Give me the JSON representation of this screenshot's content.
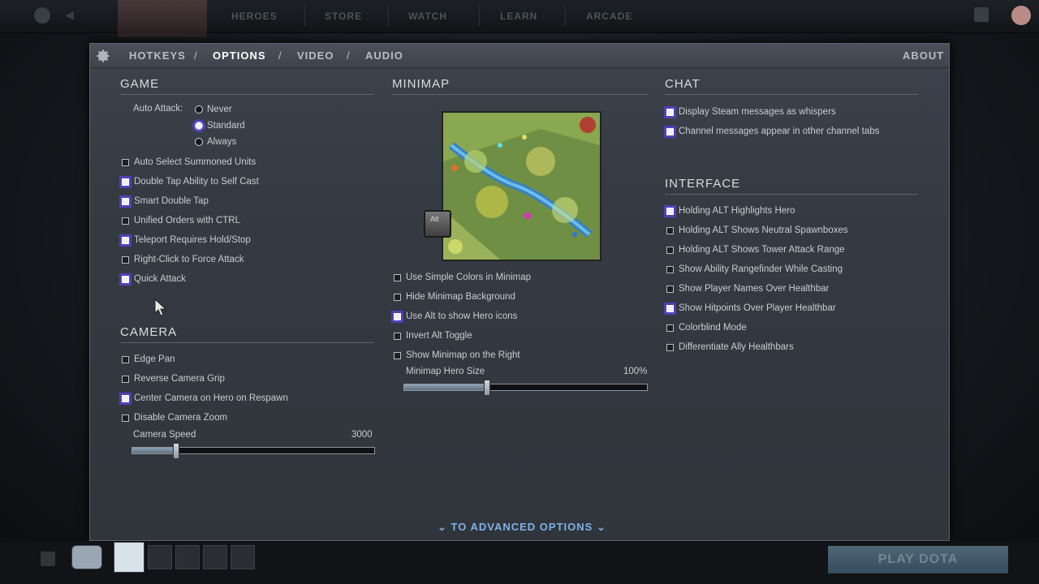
{
  "topnav": {
    "items": [
      "HEROES",
      "STORE",
      "WATCH",
      "LEARN",
      "ARCADE"
    ]
  },
  "tabs": {
    "hotkeys": "HOTKEYS",
    "options": "OPTIONS",
    "video": "VIDEO",
    "audio": "AUDIO",
    "separator": "/",
    "about": "ABOUT",
    "active": "OPTIONS"
  },
  "game": {
    "title": "GAME",
    "auto_attack_label": "Auto Attack:",
    "auto_attack_options": [
      {
        "label": "Never",
        "selected": false
      },
      {
        "label": "Standard",
        "selected": true
      },
      {
        "label": "Always",
        "selected": false
      }
    ],
    "checkboxes": [
      {
        "label": "Auto Select Summoned Units",
        "checked": false
      },
      {
        "label": "Double Tap Ability to Self Cast",
        "checked": true
      },
      {
        "label": "Smart Double Tap",
        "checked": true
      },
      {
        "label": "Unified Orders with CTRL",
        "checked": false
      },
      {
        "label": "Teleport Requires Hold/Stop",
        "checked": true
      },
      {
        "label": "Right-Click to Force Attack",
        "checked": false
      },
      {
        "label": "Quick Attack",
        "checked": true
      }
    ]
  },
  "camera": {
    "title": "CAMERA",
    "checkboxes": [
      {
        "label": "Edge Pan",
        "checked": false
      },
      {
        "label": "Reverse Camera Grip",
        "checked": false
      },
      {
        "label": "Center Camera on Hero on Respawn",
        "checked": true
      },
      {
        "label": "Disable Camera Zoom",
        "checked": false
      }
    ],
    "speed_label": "Camera Speed",
    "speed_value": "3000",
    "speed_fraction": 0.18
  },
  "minimap": {
    "title": "MINIMAP",
    "alt_key_label": "Alt",
    "checkboxes": [
      {
        "label": "Use Simple Colors in Minimap",
        "checked": false
      },
      {
        "label": "Hide Minimap Background",
        "checked": false
      },
      {
        "label": "Use Alt to show Hero icons",
        "checked": true
      },
      {
        "label": "Invert Alt Toggle",
        "checked": false
      },
      {
        "label": "Show Minimap on the Right",
        "checked": false
      }
    ],
    "hero_size_label": "Minimap Hero Size",
    "hero_size_value": "100%",
    "hero_size_fraction": 0.34
  },
  "chat": {
    "title": "CHAT",
    "checkboxes": [
      {
        "label": "Display Steam messages as whispers",
        "checked": true
      },
      {
        "label": "Channel messages appear in other channel tabs",
        "checked": true
      }
    ]
  },
  "interface": {
    "title": "INTERFACE",
    "checkboxes": [
      {
        "label": "Holding ALT Highlights Hero",
        "checked": true
      },
      {
        "label": "Holding ALT Shows Neutral Spawnboxes",
        "checked": false
      },
      {
        "label": "Holding ALT Shows Tower Attack Range",
        "checked": false
      },
      {
        "label": "Show Ability Rangefinder While Casting",
        "checked": false
      },
      {
        "label": "Show Player Names Over Healthbar",
        "checked": false
      },
      {
        "label": "Show Hitpoints Over Player Healthbar",
        "checked": true
      },
      {
        "label": "Colorblind Mode",
        "checked": false
      },
      {
        "label": "Differentiate Ally Healthbars",
        "checked": false
      }
    ]
  },
  "advanced_link": "TO ADVANCED OPTIONS",
  "play_button": "PLAY DOTA",
  "colors": {
    "accent_check": "#5040b8",
    "link": "#7fb2e6",
    "panel_bg": "#383e46"
  }
}
